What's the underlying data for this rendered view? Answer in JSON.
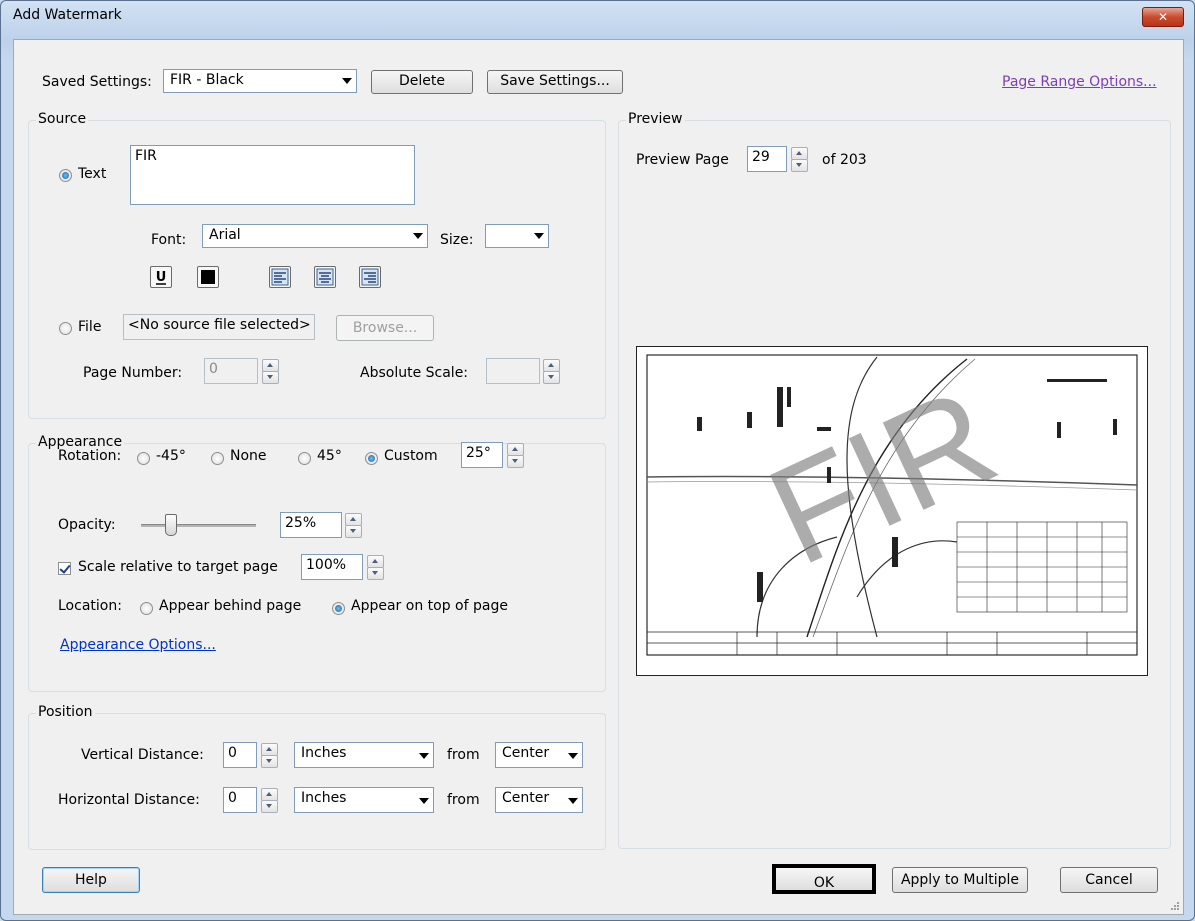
{
  "window": {
    "title": "Add Watermark",
    "close_label": "✕"
  },
  "saved_settings": {
    "label": "Saved Settings:",
    "value": "FIR - Black",
    "delete_label": "Delete",
    "save_label": "Save Settings..."
  },
  "page_range_link": "Page Range Options...",
  "source": {
    "title": "Source",
    "text_option": "Text",
    "text_value": "FIR",
    "font_label": "Font:",
    "font_value": "Arial",
    "size_label": "Size:",
    "size_value": "",
    "file_option": "File",
    "file_value": "<No source file selected>",
    "browse_label": "Browse...",
    "page_number_label": "Page Number:",
    "page_number_value": "0",
    "absolute_scale_label": "Absolute Scale:",
    "absolute_scale_value": ""
  },
  "appearance": {
    "title": "Appearance",
    "rotation_label": "Rotation:",
    "rot_m45": "-45°",
    "rot_none": "None",
    "rot_45": "45°",
    "rot_custom": "Custom",
    "rot_value": "25°",
    "opacity_label": "Opacity:",
    "opacity_value": "25%",
    "opacity_level": 0.25,
    "scale_label": "Scale relative to target page",
    "scale_value": "100%",
    "location_label": "Location:",
    "behind_label": "Appear behind page",
    "ontop_label": "Appear on top of page",
    "options_link": "Appearance Options..."
  },
  "position": {
    "title": "Position",
    "vertical_label": "Vertical Distance:",
    "vertical_value": "0",
    "vertical_unit": "Inches",
    "vertical_from_label": "from",
    "vertical_from": "Center",
    "horizontal_label": "Horizontal Distance:",
    "horizontal_value": "0",
    "horizontal_unit": "Inches",
    "horizontal_from_label": "from",
    "horizontal_from": "Center"
  },
  "preview": {
    "title": "Preview",
    "page_label": "Preview Page",
    "page_value": "29",
    "of_label": "of 203",
    "watermark_text": "FIR"
  },
  "footer": {
    "help": "Help",
    "ok": "OK",
    "apply_multiple": "Apply to Multiple",
    "cancel": "Cancel"
  },
  "colors": {
    "accent": "#0033cc",
    "link_visited": "#7b3fb6",
    "window_frame": "#c5d8ee"
  }
}
